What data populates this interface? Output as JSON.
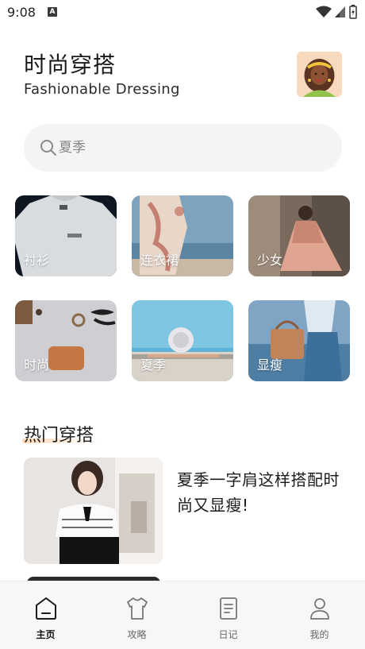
{
  "status_bar": {
    "time": "9:08",
    "notification_badge": "A",
    "icons": [
      "wifi-icon",
      "signal-icon",
      "battery-charging-icon"
    ]
  },
  "header": {
    "title": "时尚穿搭",
    "subtitle": "Fashionable Dressing",
    "avatar_icon": "avatar-woman-illustration"
  },
  "search": {
    "placeholder": "夏季",
    "icon": "search-icon"
  },
  "categories": [
    {
      "label": "衬衫"
    },
    {
      "label": "连衣裙"
    },
    {
      "label": "少女"
    },
    {
      "label": "时尚"
    },
    {
      "label": "夏季"
    },
    {
      "label": "显瘦"
    }
  ],
  "hot": {
    "section_title": "热门穿搭",
    "articles": [
      {
        "title": "夏季一字肩这样搭配时尚又显瘦!"
      }
    ]
  },
  "bottom_nav": {
    "active": "主页",
    "items": [
      {
        "label": "主页",
        "icon": "home-icon"
      },
      {
        "label": "攻略",
        "icon": "tshirt-icon"
      },
      {
        "label": "日记",
        "icon": "notebook-icon"
      },
      {
        "label": "我的",
        "icon": "user-icon"
      }
    ]
  },
  "colors": {
    "background": "#ffffff",
    "search_bg": "#f3f4f6",
    "nav_bg": "#f7f7f8",
    "accent_underline": "#fac896"
  }
}
